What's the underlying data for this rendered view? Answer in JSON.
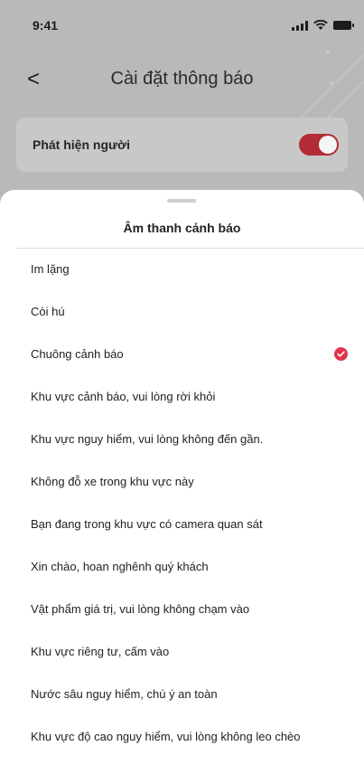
{
  "status_bar": {
    "time": "9:41"
  },
  "nav": {
    "back_label": "<",
    "title": "Cài đặt thông báo"
  },
  "settings_card": {
    "label": "Phát hiện người",
    "toggle_on": true
  },
  "sheet": {
    "title": "Âm thanh cảnh báo",
    "options": [
      {
        "label": "Im lặng",
        "selected": false
      },
      {
        "label": "Còi hú",
        "selected": false
      },
      {
        "label": "Chuông cảnh báo",
        "selected": true
      },
      {
        "label": "Khu vực cảnh báo, vui lòng rời khỏi",
        "selected": false
      },
      {
        "label": "Khu vực nguy hiểm, vui lòng không đến gần.",
        "selected": false
      },
      {
        "label": "Không đỗ xe trong khu vực này",
        "selected": false
      },
      {
        "label": "Bạn đang trong khu vực có camera quan sát",
        "selected": false
      },
      {
        "label": "Xin chào, hoan nghênh quý khách",
        "selected": false
      },
      {
        "label": "Vật phẩm giá trị, vui lòng không chạm vào",
        "selected": false
      },
      {
        "label": "Khu vực riêng tư, cấm vào",
        "selected": false
      },
      {
        "label": "Nước sâu nguy hiểm, chú ý an toàn",
        "selected": false
      },
      {
        "label": "Khu vực độ cao nguy hiểm, vui lòng không leo chèo",
        "selected": false
      }
    ]
  },
  "colors": {
    "accent": "#e0344a",
    "toggle_on": "#b32b34",
    "overlay": "#b9b9b9"
  },
  "icons": {
    "check": "check-circle-icon",
    "back": "back-arrow-icon"
  }
}
